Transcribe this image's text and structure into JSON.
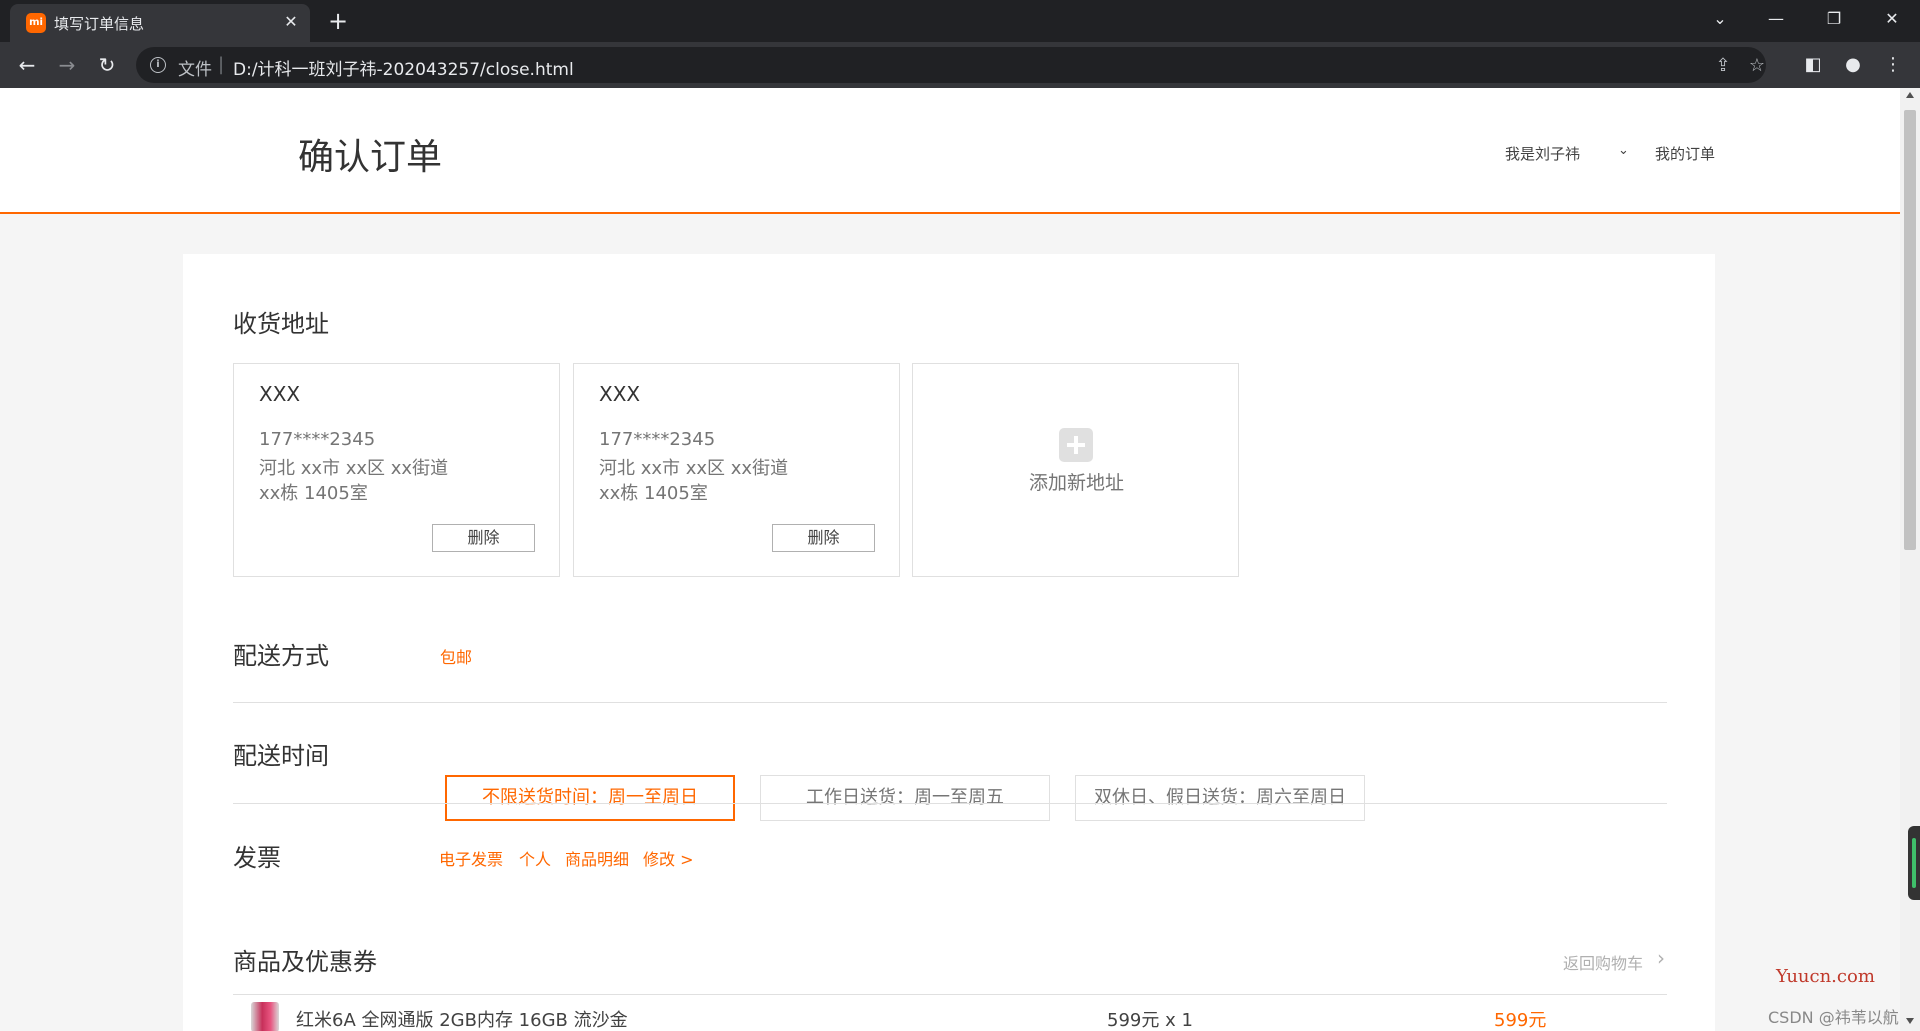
{
  "browser": {
    "tab_favicon": "mi",
    "tab_title": "填写订单信息",
    "tab_close": "✕",
    "new_tab": "+",
    "url_scheme": "文件",
    "url_separator": "|",
    "url": "D:/计科一班刘子祎-202043257/close.html",
    "icons": [
      "back-icon",
      "forward-icon",
      "reload-icon",
      "info-icon",
      "share-icon",
      "bookmark-star-icon",
      "side-panel-icon",
      "profile-icon",
      "menu-icon"
    ]
  },
  "header": {
    "title": "确认订单",
    "user": "我是刘子祎",
    "user_arrow": "⌄",
    "my_orders": "我的订单"
  },
  "address_section": {
    "title": "收货地址",
    "cards": [
      {
        "name": "XXX",
        "phone": "177****2345",
        "line1": "河北 xx市 xx区 xx街道",
        "line2": "xx栋 1405室",
        "delete_label": "删除"
      },
      {
        "name": "XXX",
        "phone": "177****2345",
        "line1": "河北 xx市 xx区 xx街道",
        "line2": "xx栋 1405室",
        "delete_label": "删除"
      }
    ],
    "add_label": "添加新地址"
  },
  "shipping": {
    "title": "配送方式",
    "value": "包邮"
  },
  "delivery_time": {
    "title": "配送时间",
    "options": [
      {
        "label": "不限送货时间：周一至周日",
        "selected": true
      },
      {
        "label": "工作日送货：周一至周五",
        "selected": false
      },
      {
        "label": "双休日、假日送货：周六至周日",
        "selected": false
      }
    ]
  },
  "invoice": {
    "title": "发票",
    "items": [
      "电子发票",
      "个人",
      "商品明细",
      "修改 >"
    ]
  },
  "products": {
    "title": "商品及优惠券",
    "back_to_cart": "返回购物车",
    "items": [
      {
        "name": "红米6A 全网通版 2GB内存 16GB 流沙金",
        "unit_price": "599元 x 1",
        "total": "599元"
      }
    ]
  },
  "watermarks": {
    "yuucn": "Yuucn.com",
    "csdn": "CSDN @祎苇以航"
  },
  "colors": {
    "accent": "#ff6700",
    "chrome_dark": "#202124",
    "chrome_toolbar": "#35363a"
  }
}
